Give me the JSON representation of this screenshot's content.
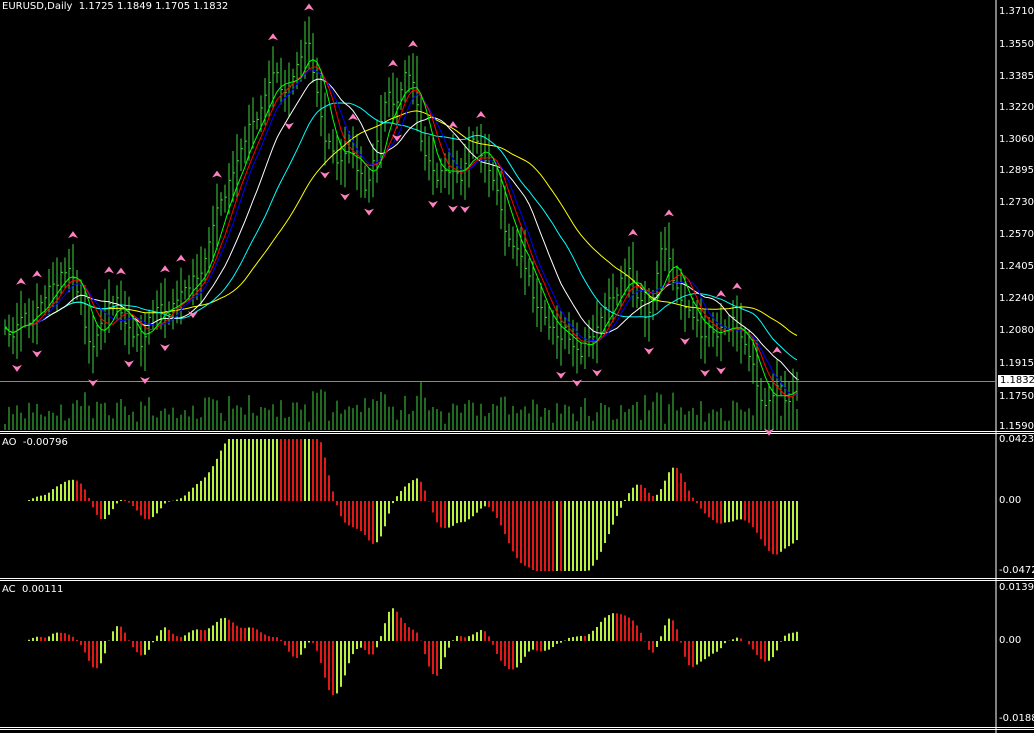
{
  "header": {
    "symbol": "EURUSD,Daily",
    "ohlc": "1.1725 1.1849 1.1705 1.1832"
  },
  "price_axis": [
    "1.3710",
    "1.3550",
    "1.3385",
    "1.3220",
    "1.3060",
    "1.2895",
    "1.2730",
    "1.2570",
    "1.2405",
    "1.2240",
    "1.2080",
    "1.1915",
    "1.1750",
    "1.1590"
  ],
  "current_price": "1.1832",
  "ao": {
    "label": "AO",
    "value": "-0.00796",
    "axis": [
      "0.0423",
      "0.00",
      "-0.0472"
    ]
  },
  "ac": {
    "label": "AC",
    "value": "0.00111",
    "axis": [
      "0.0139",
      "0.00",
      "-0.0188"
    ]
  },
  "colors": {
    "bars": "#3fd43f",
    "volume": "#3fd43f",
    "up": "#b8f040",
    "down": "#e01818",
    "fractal": "#ff80c0",
    "ma": [
      "#ffff00",
      "#00ffff",
      "#ffffff",
      "#0000ff",
      "#ff0000",
      "#00ff00"
    ]
  },
  "chart_data": {
    "type": "bar",
    "symbol": "EURUSD",
    "timeframe": "Daily",
    "ylim": [
      1.159,
      1.371
    ],
    "closes": [
      1.21,
      1.205,
      1.215,
      1.212,
      1.22,
      1.225,
      1.232,
      1.238,
      1.24,
      1.228,
      1.21,
      1.2,
      1.212,
      1.222,
      1.225,
      1.212,
      1.205,
      1.2,
      1.215,
      1.22,
      1.218,
      1.222,
      1.228,
      1.23,
      1.235,
      1.245,
      1.262,
      1.275,
      1.285,
      1.295,
      1.305,
      1.315,
      1.322,
      1.335,
      1.34,
      1.33,
      1.338,
      1.348,
      1.355,
      1.33,
      1.305,
      1.3,
      1.295,
      1.305,
      1.29,
      1.28,
      1.295,
      1.315,
      1.33,
      1.325,
      1.34,
      1.335,
      1.305,
      1.295,
      1.285,
      1.29,
      1.295,
      1.285,
      1.3,
      1.305,
      1.295,
      1.285,
      1.27,
      1.255,
      1.25,
      1.24,
      1.225,
      1.22,
      1.21,
      1.205,
      1.21,
      1.2,
      1.195,
      1.205,
      1.21,
      1.22,
      1.225,
      1.235,
      1.24,
      1.225,
      1.215,
      1.225,
      1.25,
      1.245,
      1.23,
      1.22,
      1.215,
      1.205,
      1.21,
      1.205,
      1.21,
      1.215,
      1.205,
      1.195,
      1.18,
      1.17,
      1.175,
      1.18,
      1.172,
      1.1832
    ],
    "ao_range": [
      -0.0472,
      0.0423
    ],
    "ac_range": [
      -0.0188,
      0.0139
    ]
  }
}
